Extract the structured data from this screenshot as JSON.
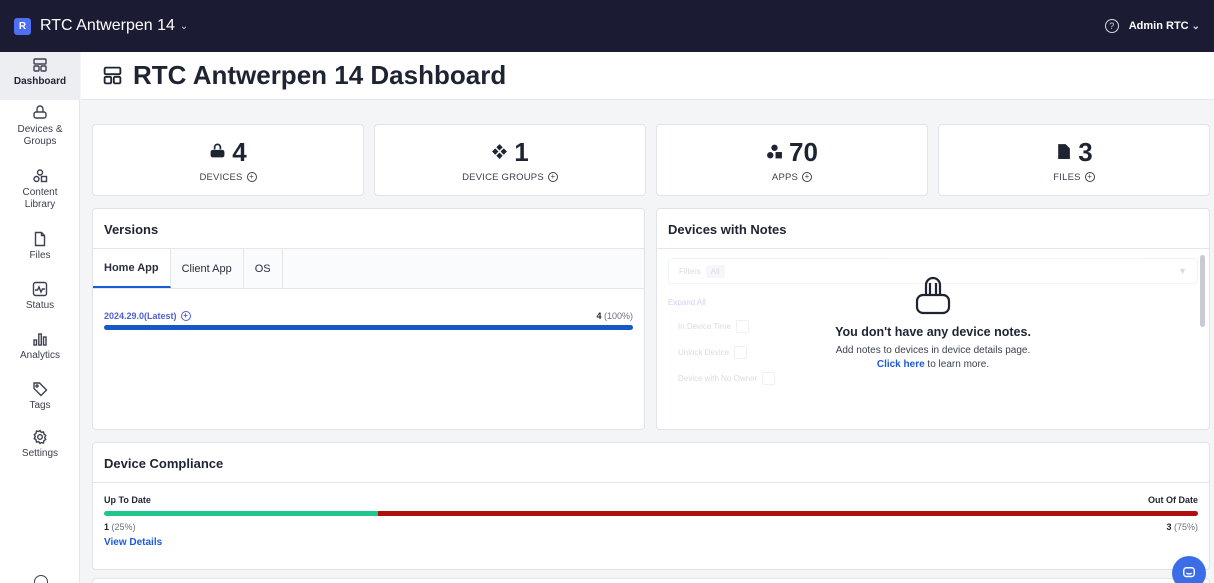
{
  "topbar": {
    "org_badge": "R",
    "org_name": "RTC Antwerpen 14",
    "help_icon": "question-circle-icon",
    "user": "Admin RTC"
  },
  "sidebar": {
    "items": [
      {
        "label": "Dashboard",
        "icon": "dashboard-icon"
      },
      {
        "label": "Devices & Groups",
        "icon": "headset-icon"
      },
      {
        "label": "Content Library",
        "icon": "shapes-icon"
      },
      {
        "label": "Files",
        "icon": "file-icon"
      },
      {
        "label": "Status",
        "icon": "pulse-icon"
      },
      {
        "label": "Analytics",
        "icon": "bar-chart-icon"
      },
      {
        "label": "Tags",
        "icon": "tag-icon"
      },
      {
        "label": "Settings",
        "icon": "gear-icon"
      }
    ]
  },
  "header": {
    "title": "RTC Antwerpen 14 Dashboard"
  },
  "stats": [
    {
      "value": "4",
      "label": "DEVICES",
      "icon": "headset-icon"
    },
    {
      "value": "1",
      "label": "DEVICE GROUPS",
      "icon": "diamond-cluster-icon"
    },
    {
      "value": "70",
      "label": "APPS",
      "icon": "shapes-icon"
    },
    {
      "value": "3",
      "label": "FILES",
      "icon": "file-icon"
    }
  ],
  "versions": {
    "title": "Versions",
    "tabs": [
      "Home App",
      "Client App",
      "OS"
    ],
    "active_tab": "Home App",
    "row": {
      "name": "2024.29.0(Latest)",
      "count": "4",
      "percent": "(100%)",
      "fraction": 1.0
    }
  },
  "notes": {
    "title": "Devices with Notes",
    "empty_title": "You don't have any device notes.",
    "empty_desc": "Add notes to devices in device details page.",
    "link_text": "Click here",
    "link_suffix": " to learn more.",
    "ghost": {
      "filter_label": "Filters",
      "filter_chip": "All",
      "expand_all": "Expand All",
      "items": [
        "In Device Time",
        "Unlock Device",
        "Device with No Owner"
      ]
    }
  },
  "compliance": {
    "title": "Device Compliance",
    "left_label": "Up To Date",
    "right_label": "Out Of Date",
    "left_count": "1",
    "left_percent": "(25%)",
    "right_count": "3",
    "right_percent": "(75%)",
    "up_fraction": 0.25,
    "out_fraction": 0.75,
    "view_details": "View Details",
    "colors": {
      "up": "#1fc78d",
      "out": "#b00f0f"
    }
  },
  "colors": {
    "topbar": "#1b1c33",
    "accent": "#1a5bd8",
    "version_bar": "#1558c7"
  }
}
